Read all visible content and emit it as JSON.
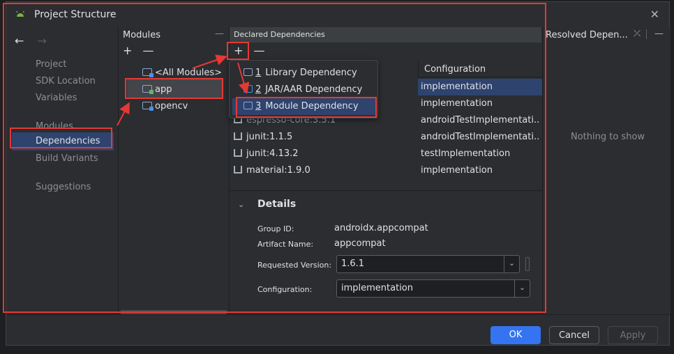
{
  "window": {
    "title": "Project Structure"
  },
  "nav": {
    "back_icon": "arrow-left-icon",
    "forward_icon": "arrow-right-icon",
    "items": [
      {
        "label": "Project"
      },
      {
        "label": "SDK Location"
      },
      {
        "label": "Variables"
      },
      {
        "label": "Modules"
      },
      {
        "label": "Dependencies",
        "selected": true
      },
      {
        "label": "Build Variants"
      },
      {
        "label": "Suggestions"
      }
    ]
  },
  "modules": {
    "header": "Modules",
    "items": [
      {
        "label": "<All Modules>"
      },
      {
        "label": "app",
        "selected": true
      },
      {
        "label": "opencv"
      }
    ]
  },
  "declared": {
    "header": "Declared Dependencies",
    "config_header": "Configuration",
    "rows": [
      {
        "name": "",
        "config": "implementation",
        "selected": true
      },
      {
        "name": "",
        "config": "implementation"
      },
      {
        "name": "espresso-core:3.5.1",
        "config": "androidTestImplementati..."
      },
      {
        "name": "junit:1.1.5",
        "config": "androidTestImplementati..."
      },
      {
        "name": "junit:4.13.2",
        "config": "testImplementation"
      },
      {
        "name": "material:1.9.0",
        "config": "implementation"
      }
    ]
  },
  "popup": {
    "items": [
      {
        "num": "1",
        "label": "Library Dependency"
      },
      {
        "num": "2",
        "label": "JAR/AAR Dependency"
      },
      {
        "num": "3",
        "label": "Module Dependency",
        "selected": true
      }
    ]
  },
  "details": {
    "title": "Details",
    "group_id_label": "Group ID:",
    "group_id": "androidx.appcompat",
    "artifact_label": "Artifact Name:",
    "artifact": "appcompat",
    "version_label": "Requested Version:",
    "version": "1.6.1",
    "config_label": "Configuration:",
    "config": "implementation"
  },
  "resolved": {
    "header": "Resolved Depen...",
    "empty": "Nothing to show"
  },
  "buttons": {
    "ok": "OK",
    "cancel": "Cancel",
    "apply": "Apply"
  },
  "colors": {
    "accent": "#3574f0",
    "selection": "#2e436e",
    "annotation": "#e53935"
  }
}
